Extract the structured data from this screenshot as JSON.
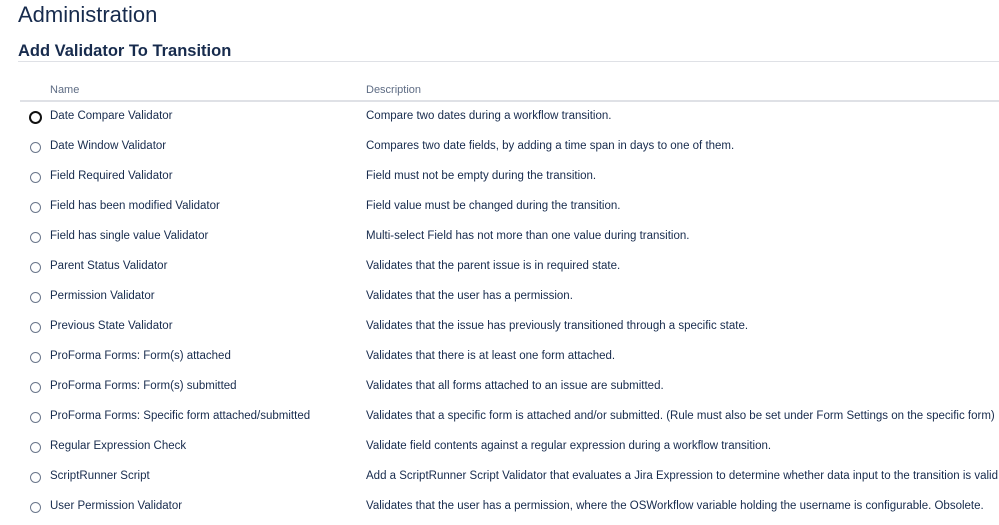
{
  "header": {
    "title": "Administration",
    "subtitle": "Add Validator To Transition"
  },
  "table": {
    "columns": [
      "Name",
      "Description"
    ],
    "rows": [
      {
        "name": "Date Compare Validator",
        "description": "Compare two dates during a workflow transition."
      },
      {
        "name": "Date Window Validator",
        "description": "Compares two date fields, by adding a time span in days to one of them."
      },
      {
        "name": "Field Required Validator",
        "description": "Field must not be empty during the transition."
      },
      {
        "name": "Field has been modified Validator",
        "description": "Field value must be changed during the transition."
      },
      {
        "name": "Field has single value Validator",
        "description": "Multi-select Field has not more than one value during transition."
      },
      {
        "name": "Parent Status Validator",
        "description": "Validates that the parent issue is in required state."
      },
      {
        "name": "Permission Validator",
        "description": "Validates that the user has a permission."
      },
      {
        "name": "Previous State Validator",
        "description": "Validates that the issue has previously transitioned through a specific state."
      },
      {
        "name": "ProForma Forms: Form(s) attached",
        "description": "Validates that there is at least one form attached."
      },
      {
        "name": "ProForma Forms: Form(s) submitted",
        "description": "Validates that all forms attached to an issue are submitted."
      },
      {
        "name": "ProForma Forms: Specific form attached/submitted",
        "description": "Validates that a specific form is attached and/or submitted. (Rule must also be set under Form Settings on the specific form)"
      },
      {
        "name": "Regular Expression Check",
        "description": "Validate field contents against a regular expression during a workflow transition."
      },
      {
        "name": "ScriptRunner Script",
        "description": "Add a ScriptRunner Script Validator that evaluates a Jira Expression to determine whether data input to the transition is valid."
      },
      {
        "name": "User Permission Validator",
        "description": "Validates that the user has a permission, where the OSWorkflow variable holding the username is configurable. Obsolete."
      }
    ]
  }
}
